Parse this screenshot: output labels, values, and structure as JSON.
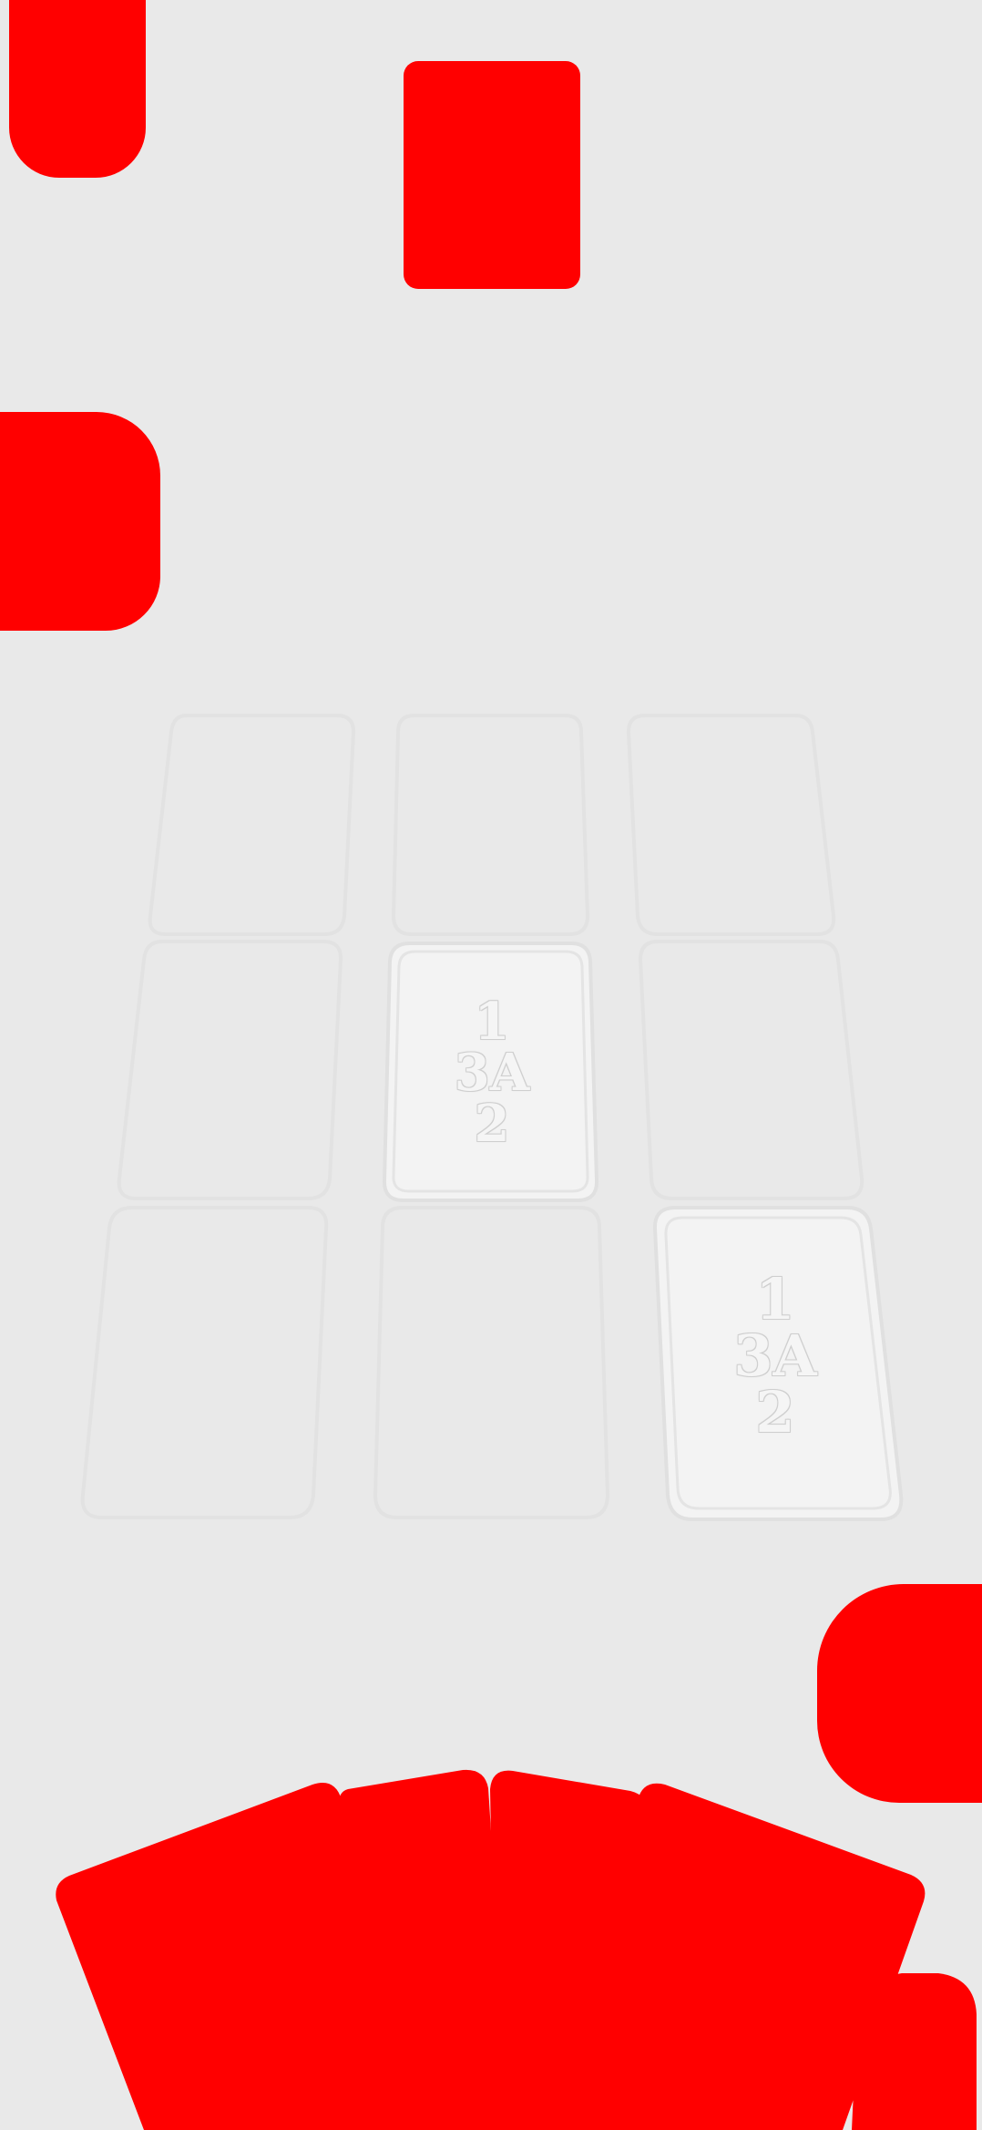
{
  "colors": {
    "background": "#e9e9e9",
    "card_back": "#ff0000",
    "slot_outline": "#e2e2e2",
    "placed_card_fill": "#f3f3f3",
    "card_text": "#f5f5f5"
  },
  "opponent": {
    "hand_count": 1
  },
  "board": {
    "rows": 3,
    "cols": 3,
    "placed_cards": [
      {
        "row": 2,
        "col": 2,
        "top": "1",
        "left": "3",
        "right": "A",
        "bottom": "2"
      },
      {
        "row": 3,
        "col": 3,
        "top": "1",
        "left": "3",
        "right": "A",
        "bottom": "2"
      }
    ]
  },
  "player": {
    "hand_count": 5
  }
}
